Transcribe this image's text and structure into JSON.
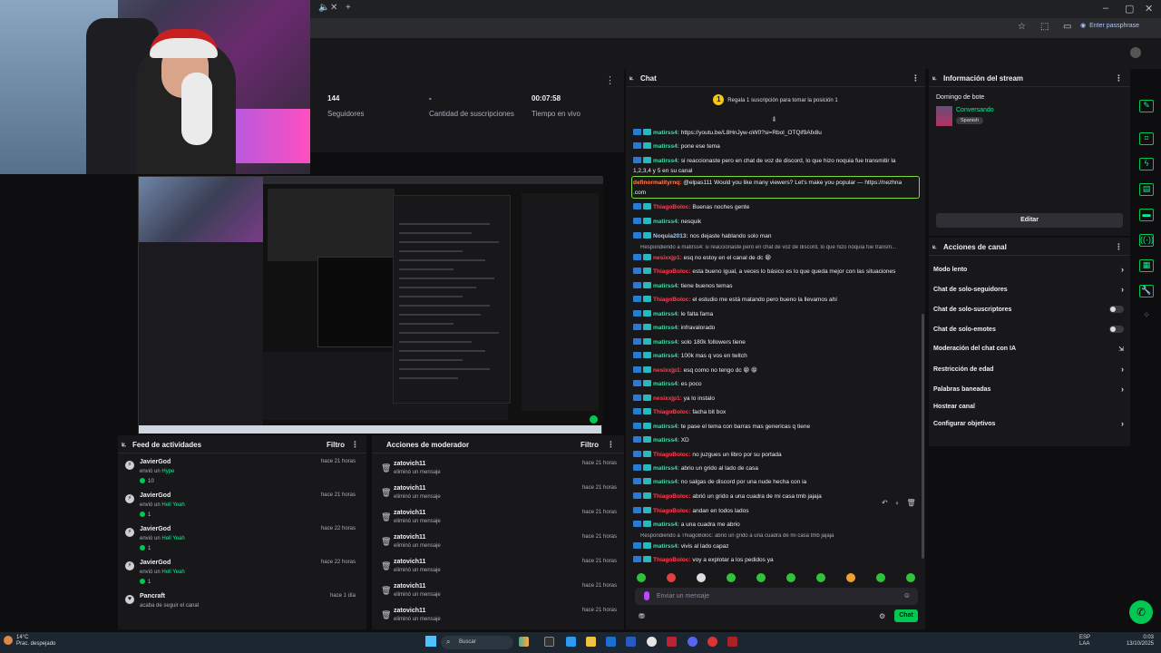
{
  "browser": {
    "passphrase_label": "Enter passphrase"
  },
  "stats": {
    "followers_value": "144",
    "followers_label": "Seguidores",
    "subs_value": "-",
    "subs_label": "Cantidad de suscripciones",
    "live_value": "00:07:58",
    "live_label": "Tiempo en vivo"
  },
  "activity": {
    "title": "Feed de actividades",
    "filter": "Filtro",
    "items": [
      {
        "name": "JavierGod",
        "verb": "envió un",
        "item": "Hype",
        "count": "10",
        "time": "hace 21 horas"
      },
      {
        "name": "JavierGod",
        "verb": "envió un",
        "item": "Hell Yeah",
        "count": "1",
        "time": "hace 21 horas"
      },
      {
        "name": "JavierGod",
        "verb": "envió un",
        "item": "Hell Yeah",
        "count": "1",
        "time": "hace 22 horas"
      },
      {
        "name": "JavierGod",
        "verb": "envió un",
        "item": "Hell Yeah",
        "count": "1",
        "time": "hace 22 horas"
      },
      {
        "name": "Pancraft",
        "verb": "acaba de seguir el canal",
        "item": "",
        "count": "",
        "time": "hace 1 día"
      }
    ]
  },
  "modactions": {
    "title": "Acciones de moderador",
    "filter": "Filtro",
    "items": [
      {
        "name": "zatovich11",
        "desc": "eliminó un mensaje",
        "time": "hace 21 horas"
      },
      {
        "name": "zatovich11",
        "desc": "eliminó un mensaje",
        "time": "hace 21 horas"
      },
      {
        "name": "zatovich11",
        "desc": "eliminó un mensaje",
        "time": "hace 21 horas"
      },
      {
        "name": "zatovich11",
        "desc": "eliminó un mensaje",
        "time": "hace 21 horas"
      },
      {
        "name": "zatovich11",
        "desc": "eliminó un mensaje",
        "time": "hace 21 horas"
      },
      {
        "name": "zatovich11",
        "desc": "eliminó un mensaje",
        "time": "hace 21 horas"
      },
      {
        "name": "zatovich11",
        "desc": "eliminó un mensaje",
        "time": "hace 21 horas"
      }
    ]
  },
  "chat": {
    "title": "Chat",
    "gift": "Regala 1 suscripción para tomar la posición 1",
    "input_placeholder": "Enviar un mensaje",
    "send_label": "Chat",
    "messages": [
      {
        "user": "matirss4:",
        "cls": "u1",
        "text": "https://youtu.be/L8HnJyw-oW0?si=Rbol_OTQif9Afx8u"
      },
      {
        "user": "matirss4:",
        "cls": "u1",
        "text": "pone ese tema"
      },
      {
        "user": "matirss4:",
        "cls": "u1",
        "text": "si reaccionaste pero en chat de voz de discord, lo que hizo noquia fue transmitir la"
      },
      {
        "user": "",
        "cls": "",
        "text": "1,2,3,4 y 5 en su canal"
      },
      {
        "user": "definormalityrnq:",
        "cls": "u4",
        "text": "@elpas111 Would you like many viewers? Let's make you popular — https://nezhna"
      },
      {
        "user": "",
        "cls": "",
        "text": ".com"
      },
      {
        "user": "ThiagoBoloc:",
        "cls": "u2",
        "text": "Buenas noches gente"
      },
      {
        "user": "matirss4:",
        "cls": "u1",
        "text": "nesquik"
      },
      {
        "user": "Noquia2013:",
        "cls": "u3",
        "text": "nos dejaste hablando solo man"
      },
      {
        "user": "",
        "cls": "rep",
        "text": "Respondiendo a matirss4: si reaccionaste pero en chat de voz de discord, lo que hizo noquia fue transm..."
      },
      {
        "user": "nesixxjp1:",
        "cls": "u2b",
        "text": "esq no estoy en el canal de dc 😁"
      },
      {
        "user": "ThiagoBoloc:",
        "cls": "u2",
        "text": "esta bueno igual, a veces lo básico es lo que queda mejor con las situaciones"
      },
      {
        "user": "matirss4:",
        "cls": "u1",
        "text": "tiene buenos temas"
      },
      {
        "user": "ThiagoBoloc:",
        "cls": "u2",
        "text": "el estudio me está matando pero bueno la llevamos ahí"
      },
      {
        "user": "matirss4:",
        "cls": "u1",
        "text": "le falta fama"
      },
      {
        "user": "matirss4:",
        "cls": "u1",
        "text": "infravalorado"
      },
      {
        "user": "matirss4:",
        "cls": "u1",
        "text": "solo 180k followers tiene"
      },
      {
        "user": "matirss4:",
        "cls": "u1",
        "text": "100k mas q vos en twitch"
      },
      {
        "user": "nesixxjp1:",
        "cls": "u2b",
        "text": "esq como no tengo dc 😁 😁"
      },
      {
        "user": "matirss4:",
        "cls": "u1",
        "text": "es poco"
      },
      {
        "user": "nesixxjp1:",
        "cls": "u2b",
        "text": "ya lo instalo"
      },
      {
        "user": "ThiagoBoloc:",
        "cls": "u2",
        "text": "facha bit box"
      },
      {
        "user": "matirss4:",
        "cls": "u1",
        "text": "te pase el tema con barras mas genericas q tiene"
      },
      {
        "user": "matirss4:",
        "cls": "u1",
        "text": "XD"
      },
      {
        "user": "ThiagoBoloc:",
        "cls": "u2",
        "text": "no juzgues un libro por su portada"
      },
      {
        "user": "matirss4:",
        "cls": "u1",
        "text": "abrio un grido al lado de casa"
      },
      {
        "user": "matirss4:",
        "cls": "u1",
        "text": "no salgas de discord por una nude hecha con ia"
      },
      {
        "user": "ThiagoBoloc:",
        "cls": "u2",
        "text": "abrió un grido a una cuadra de mi casa tmb jajaja"
      },
      {
        "user": "ThiagoBoloc:",
        "cls": "u2",
        "text": "andan en todos lados"
      },
      {
        "user": "matirss4:",
        "cls": "u1",
        "text": "a una cuadra me abrio"
      },
      {
        "user": "",
        "cls": "rep",
        "text": "Respondiendo a ThiagoBoloc: abrió un grido a una cuadra de mi casa tmb jajaja"
      },
      {
        "user": "matirss4:",
        "cls": "u1",
        "text": "vivis al lado capaz"
      },
      {
        "user": "ThiagoBoloc:",
        "cls": "u2",
        "text": "voy a explotar a los pedidos ya"
      }
    ]
  },
  "info": {
    "title": "Información del stream",
    "stream_title": "Domingo de bote",
    "category": "Conversando",
    "tag": "Spanish",
    "edit": "Editar"
  },
  "actions": {
    "title": "Acciones de canal",
    "items": [
      {
        "label": "Modo lento",
        "kind": "chevron"
      },
      {
        "label": "Chat de solo-seguidores",
        "kind": "chevron"
      },
      {
        "label": "Chat de solo-suscriptores",
        "kind": "toggle"
      },
      {
        "label": "Chat de solo-emotes",
        "kind": "toggle"
      },
      {
        "label": "Moderación del chat con IA",
        "kind": "ext"
      },
      {
        "label": "Restricción de edad",
        "kind": "chevron"
      },
      {
        "label": "Palabras baneadas",
        "kind": "chevron"
      },
      {
        "label": "Hostear canal",
        "kind": "none"
      },
      {
        "label": "Configurar objetivos",
        "kind": "chevron"
      }
    ]
  },
  "taskbar": {
    "weather_temp": "14°C",
    "weather_desc": "Prac. despejado",
    "search": "Buscar",
    "lang1": "ESP",
    "lang2": "LAA",
    "time": "0:03",
    "date": "13/10/2025"
  }
}
